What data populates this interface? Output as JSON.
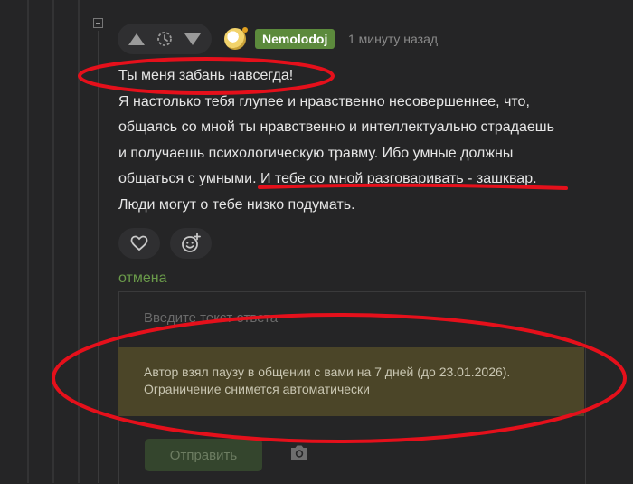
{
  "comment": {
    "author": "Nemolodoj",
    "timestamp": "1 минуту назад",
    "lines": [
      "Ты меня забань навсегда!",
      "Я настолько тебя глупее и нравственно несовершеннее, что,",
      "общаясь со мной ты нравственно и интеллектуально страдаешь",
      "и получаешь психологическую травму. Ибо умные должны",
      "общаться с умными. И тебе со мной разговаривать - зашквар.",
      "Люди могут о тебе низко подумать."
    ]
  },
  "reply": {
    "cancel_label": "отмена",
    "placeholder": "Введите текст ответа",
    "notice_line1": "Автор взял паузу в общении с вами на 7 дней (до 23.01.2026).",
    "notice_line2": "Ограничение снимется автоматически",
    "send_label": "Отправить"
  },
  "icons": {
    "upvote": "triangle-up-icon",
    "save": "clock-save-icon",
    "downvote": "triangle-down-icon",
    "like": "heart-icon",
    "reaction": "smile-plus-icon",
    "photo": "camera-icon"
  },
  "colors": {
    "background": "#252526",
    "username_badge": "#5c8a3c",
    "cancel_link": "#6a9a4a",
    "notice_bg": "#4b4528",
    "annotation_red": "#e5101b"
  }
}
